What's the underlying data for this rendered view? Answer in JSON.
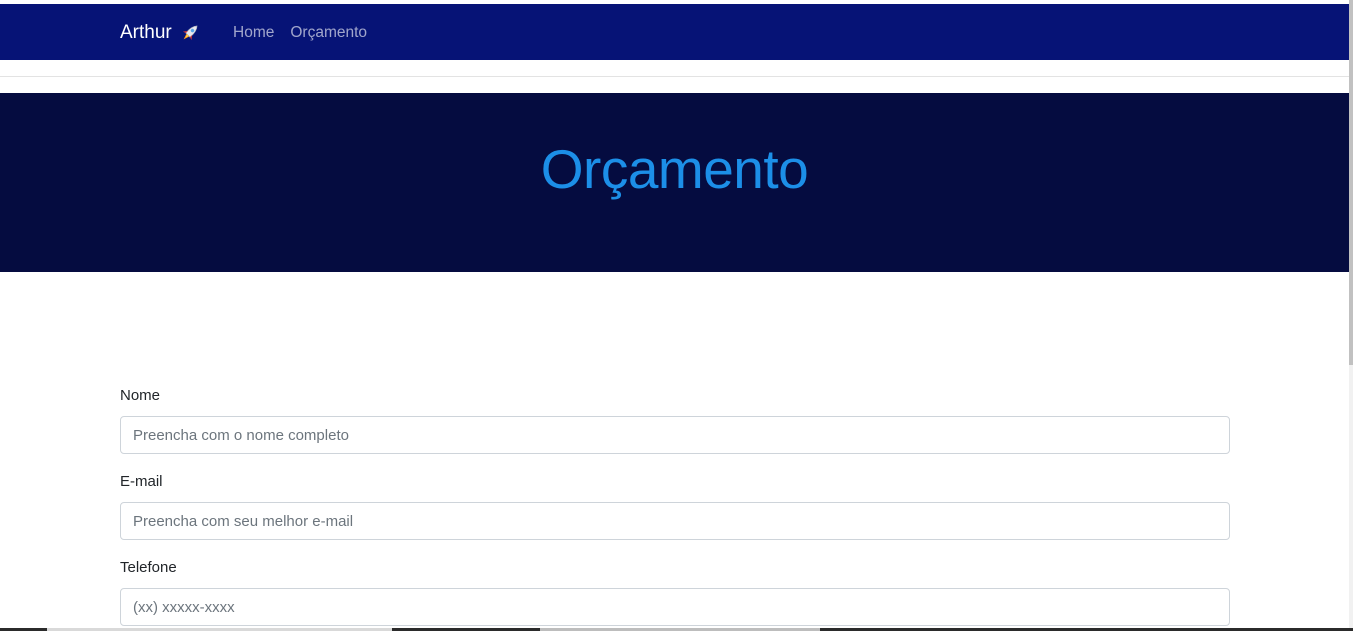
{
  "navbar": {
    "brand": "Arthur",
    "brand_icon": "rocket-icon",
    "links": [
      {
        "label": "Home"
      },
      {
        "label": "Orçamento"
      }
    ],
    "background": "#061376"
  },
  "hero": {
    "title": "Orçamento",
    "background": "#050c40",
    "title_color": "#1c8fe8"
  },
  "form": {
    "fields": [
      {
        "label": "Nome",
        "placeholder": "Preencha com o nome completo",
        "value": ""
      },
      {
        "label": "E-mail",
        "placeholder": "Preencha com seu melhor e-mail",
        "value": ""
      },
      {
        "label": "Telefone",
        "placeholder": "(xx) xxxxx-xxxx",
        "value": ""
      }
    ]
  }
}
